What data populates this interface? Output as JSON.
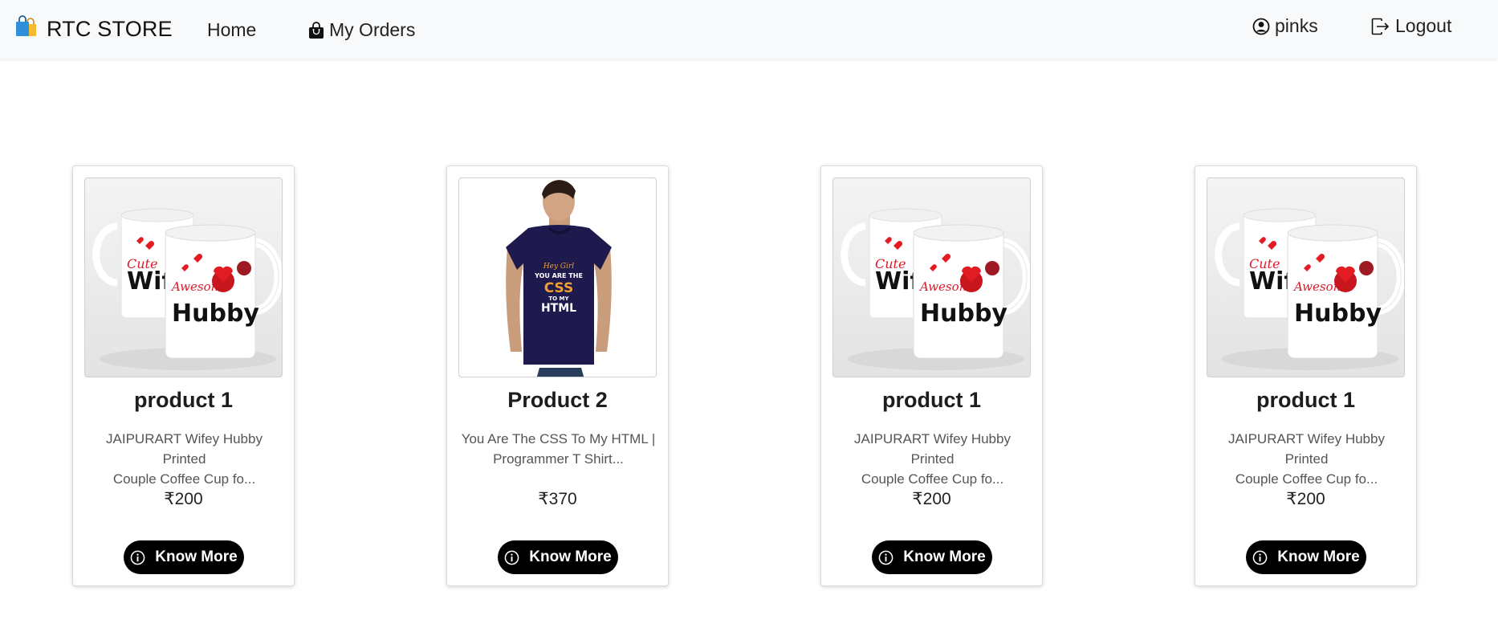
{
  "nav": {
    "brand": "RTC STORE",
    "home": "Home",
    "orders": "My Orders",
    "user": "pinks",
    "logout": "Logout"
  },
  "products": [
    {
      "title": "product 1",
      "desc_line1": "JAIPURART Wifey Hubby Printed",
      "desc_line2": "Couple Coffee Cup fo...",
      "price": "₹200",
      "button": "Know More",
      "image": "mug"
    },
    {
      "title": "Product 2",
      "desc_line1": "You Are The CSS To My HTML |",
      "desc_line2": "Programmer T Shirt...",
      "price": "₹370",
      "button": "Know More",
      "image": "tshirt"
    },
    {
      "title": "product 1",
      "desc_line1": "JAIPURART Wifey Hubby Printed",
      "desc_line2": "Couple Coffee Cup fo...",
      "price": "₹200",
      "button": "Know More",
      "image": "mug"
    },
    {
      "title": "product 1",
      "desc_line1": "JAIPURART Wifey Hubby Printed",
      "desc_line2": "Couple Coffee Cup fo...",
      "price": "₹200",
      "button": "Know More",
      "image": "mug"
    }
  ],
  "artwork": {
    "mug_back_text": "Wif",
    "mug_back_script": "Cute",
    "mug_front_text": "Hubby",
    "mug_front_script": "Awesome",
    "shirt_line1": "Hey Girl",
    "shirt_line2": "YOU ARE THE",
    "shirt_line3": "CSS",
    "shirt_line4": "TO MY",
    "shirt_line5": "HTML"
  },
  "colors": {
    "navbar_bg": "#f8f9fa",
    "button_bg": "#000000",
    "shirt": "#1f1a4d",
    "css_orange": "#f0a030",
    "heart_red": "#e31b23"
  },
  "icons": {
    "brand": "shopping-bags-icon",
    "orders": "bag-icon",
    "user": "user-circle-icon",
    "logout": "logout-icon",
    "info": "info-circle-icon"
  }
}
